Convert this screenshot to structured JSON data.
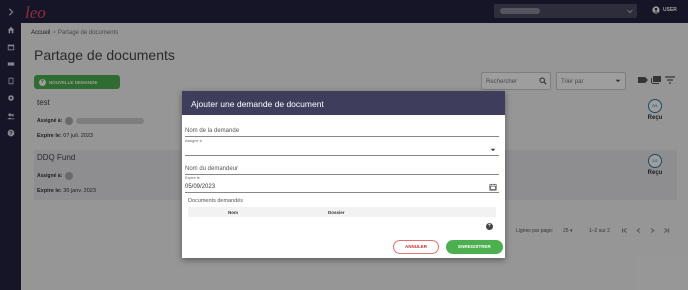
{
  "topbar": {
    "logo_text": "leo",
    "user_label": "USER"
  },
  "sidebar": {
    "items": [
      {
        "icon": "chevron-right-icon"
      },
      {
        "icon": "home-icon"
      },
      {
        "icon": "calendar-icon"
      },
      {
        "icon": "card-icon"
      },
      {
        "icon": "book-icon"
      },
      {
        "icon": "gear-icon"
      },
      {
        "icon": "people-icon"
      },
      {
        "icon": "help-icon"
      }
    ]
  },
  "breadcrumb": {
    "home": "Accueil",
    "separator": ">",
    "current": "Partage de documents"
  },
  "page": {
    "title": "Partage de documents",
    "new_button_label": "NOUVELLE DEMANDE",
    "search_placeholder": "Rechercher",
    "sort_placeholder": "Trier par"
  },
  "documents": [
    {
      "name": "test",
      "assigned_label": "Assigné à:",
      "expires_label": "Expire le:",
      "expires_value": "07 juil. 2023",
      "status_count": "0/1",
      "status_label": "Reçu"
    },
    {
      "name": "DDQ Fund",
      "assigned_label": "Assigné à:",
      "expires_label": "Expire le:",
      "expires_value": "30 janv. 2023",
      "status_count": "2/2",
      "status_label": "Reçu"
    }
  ],
  "pagination": {
    "rows_label": "Lignes par page:",
    "rows_value": "25",
    "range": "1–2 sur 2"
  },
  "modal": {
    "title": "Ajouter une demande de document",
    "request_name_placeholder": "Nom de la demande",
    "assigned_label": "Assigné à",
    "requester_placeholder": "Nom du demandeur",
    "expires_label": "Expire le",
    "expires_value": "05/09/2023",
    "documents_title": "Documents demandés",
    "columns": [
      "Nom",
      "Dossier"
    ],
    "cancel_label": "ANNULER",
    "save_label": "ENREGISTRER"
  },
  "colors": {
    "nav_bg": "#24233f",
    "modal_header": "#3e3d5c",
    "accent_green": "#4caf50",
    "cancel_red": "#d32f2f",
    "status_blue": "#2979a5",
    "logo_pink": "#e84a6f"
  }
}
